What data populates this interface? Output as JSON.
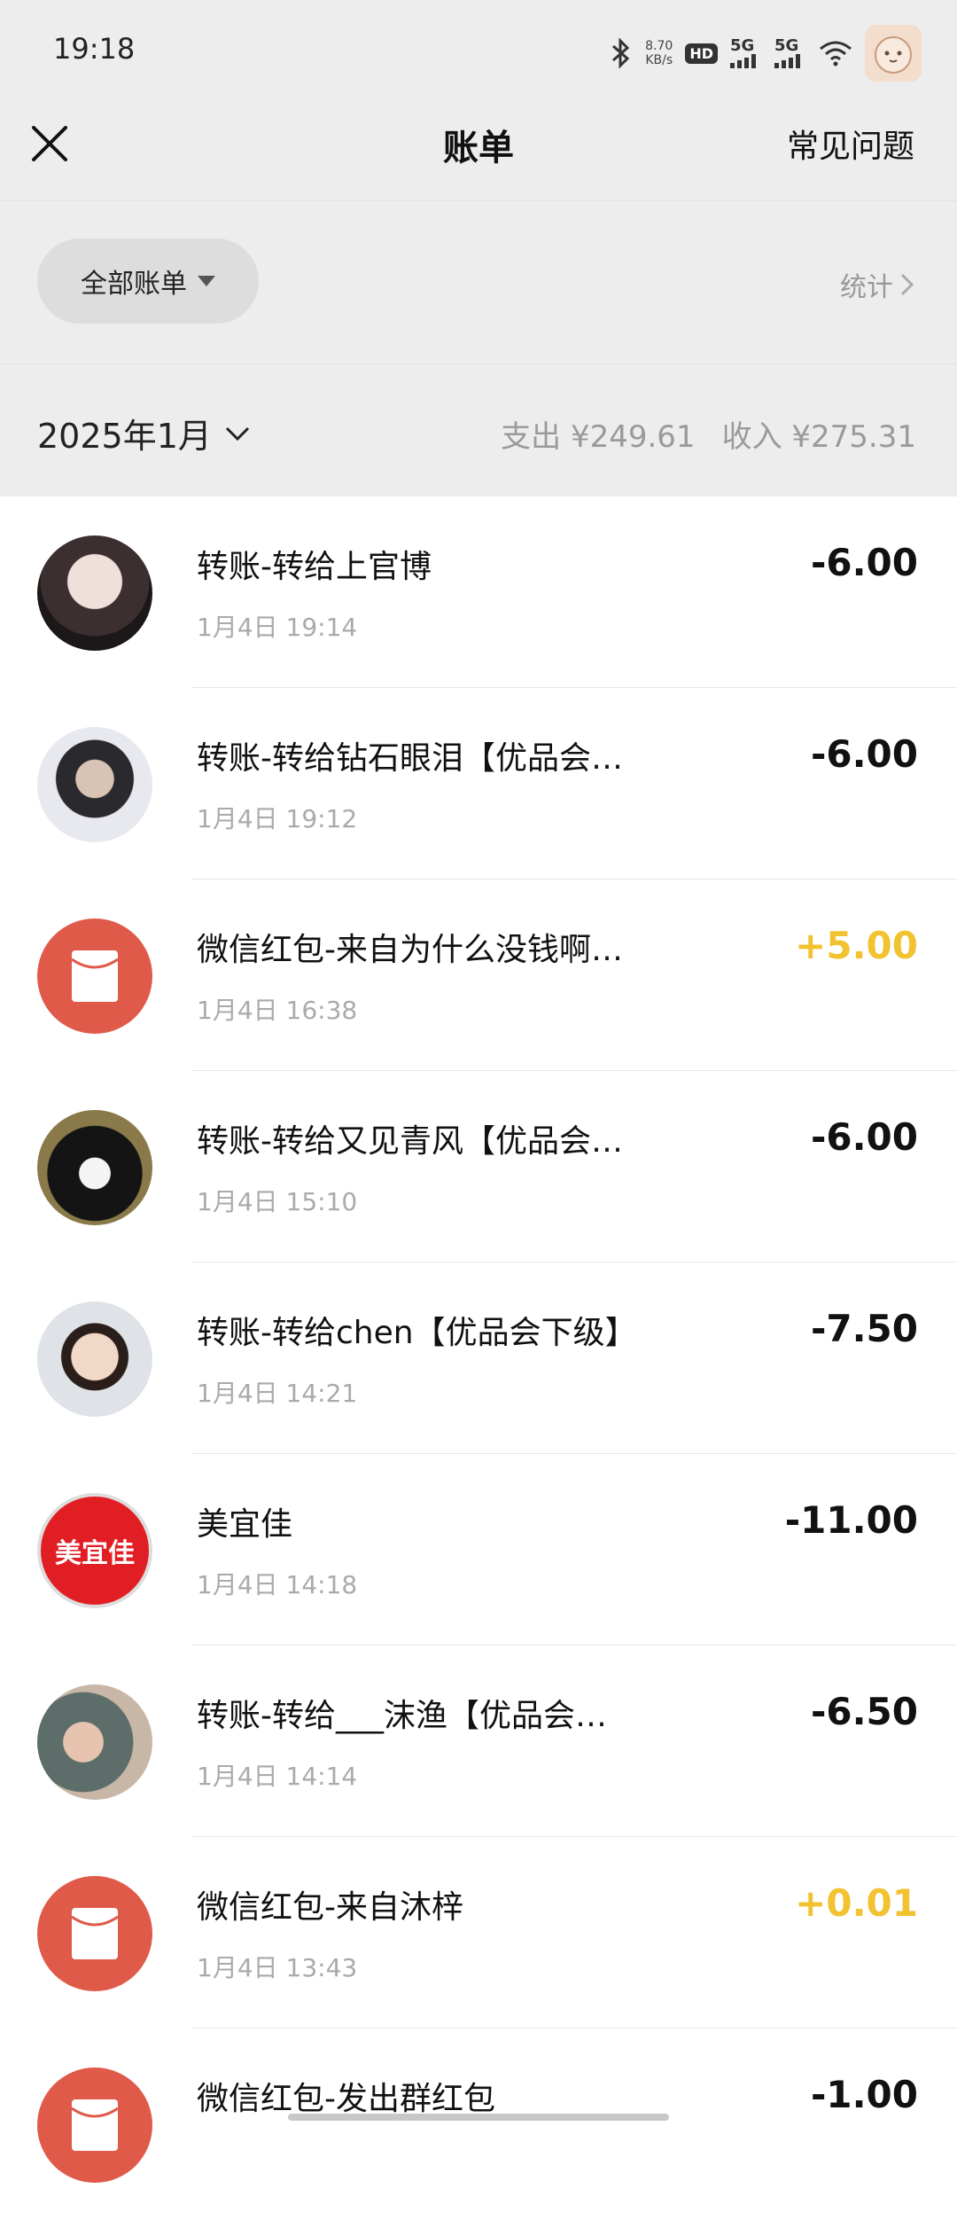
{
  "status_bar": {
    "time": "19:18",
    "speed_value": "8.70",
    "speed_unit": "KB/s",
    "hd_label": "HD",
    "net1": "5G",
    "net2": "5G"
  },
  "nav": {
    "close_icon": "close-icon",
    "title": "账单",
    "faq": "常见问题"
  },
  "filter": {
    "label": "全部账单",
    "stats": "统计"
  },
  "month": {
    "label": "2025年1月",
    "expense_label": "支出",
    "expense": "¥249.61",
    "income_label": "收入",
    "income": "¥275.31"
  },
  "transactions": [
    {
      "title": "转账-转给上官博",
      "time": "1月4日 19:14",
      "amount": "-6.00",
      "type": "expense",
      "avatar": "photo"
    },
    {
      "title": "转账-转给钻石眼泪【优品会…",
      "time": "1月4日 19:12",
      "amount": "-6.00",
      "type": "expense",
      "avatar": "photo"
    },
    {
      "title": "微信红包-来自为什么没钱啊…",
      "time": "1月4日 16:38",
      "amount": "+5.00",
      "type": "income",
      "avatar": "red-packet"
    },
    {
      "title": "转账-转给又见青风【优品会…",
      "time": "1月4日 15:10",
      "amount": "-6.00",
      "type": "expense",
      "avatar": "photo"
    },
    {
      "title": "转账-转给chen【优品会下级】",
      "time": "1月4日 14:21",
      "amount": "-7.50",
      "type": "expense",
      "avatar": "photo"
    },
    {
      "title": "美宜佳",
      "time": "1月4日 14:18",
      "amount": "-11.00",
      "type": "expense",
      "avatar": "logo",
      "logo_text": "美宜佳"
    },
    {
      "title": "转账-转给___沫渔【优品会…",
      "time": "1月4日 14:14",
      "amount": "-6.50",
      "type": "expense",
      "avatar": "photo"
    },
    {
      "title": "微信红包-来自沐梓",
      "time": "1月4日 13:43",
      "amount": "+0.01",
      "type": "income",
      "avatar": "red-packet"
    },
    {
      "title": "微信红包-发出群红包",
      "time": "",
      "amount": "-1.00",
      "type": "expense",
      "avatar": "red-packet"
    }
  ],
  "colors": {
    "income": "#f2c230",
    "red_packet": "#e05a4a",
    "header_bg": "#ededed"
  }
}
